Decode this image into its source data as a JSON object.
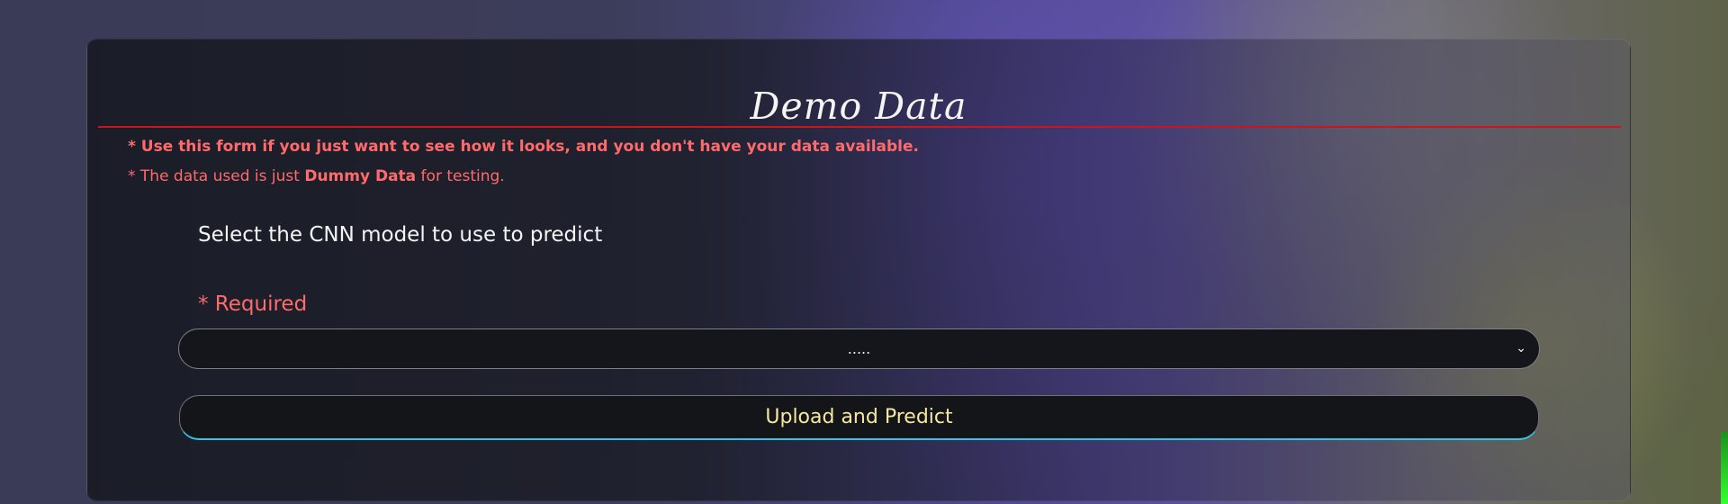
{
  "card": {
    "title": "Demo Data",
    "note_1": "* Use this form if you just want to see how it looks, and you don't have your data available.",
    "note_2_prefix": "* The data used is just ",
    "note_2_strong": "Dummy Data",
    "note_2_suffix": " for testing."
  },
  "form": {
    "model_label": "Select the CNN model to use to predict",
    "required_label": "* Required",
    "model_select_value": ".....",
    "submit_label": "Upload and Predict"
  },
  "icons": {
    "select_chevron": "chevron-down-icon"
  },
  "colors": {
    "title_rule": "#c8161e",
    "warning_text": "#ff6a6a",
    "button_text": "#f6e7a1",
    "button_accent": "#3ac3e6",
    "right_accent": "#33ff33"
  }
}
